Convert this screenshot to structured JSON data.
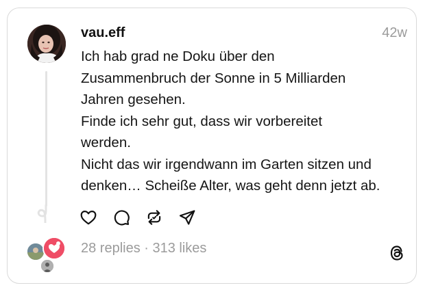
{
  "post": {
    "username": "vau.eff",
    "timestamp": "42w",
    "text_lines": [
      "Ich hab grad ne Doku über den",
      "Zusammenbruch der Sonne in 5 Milliarden",
      "Jahren gesehen.",
      "Finde ich sehr gut, dass wir vorbereitet",
      "werden.",
      "Nicht das wir irgendwann im Garten sitzen und",
      "denken… Scheiße Alter, was geht denn jetzt ab."
    ]
  },
  "actions": {
    "icons": [
      "heart-icon",
      "comment-icon",
      "repost-icon",
      "share-icon"
    ]
  },
  "footer": {
    "stats": "28 replies · 313 likes",
    "logo_icon": "threads-logo-icon"
  },
  "colors": {
    "text": "#111111",
    "muted": "#9b9b9b",
    "border": "#d9d9d9",
    "thread_line": "#e3e3e3"
  }
}
